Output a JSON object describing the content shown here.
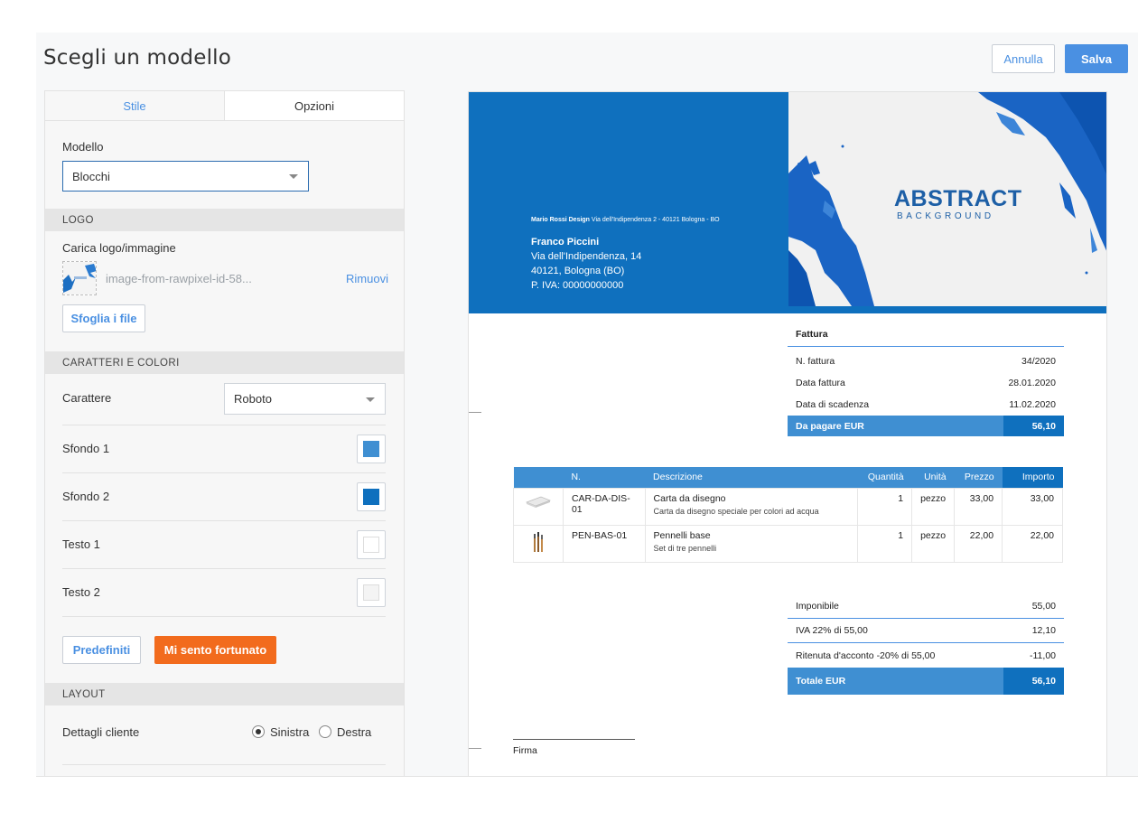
{
  "header": {
    "title": "Scegli un modello",
    "cancel_label": "Annulla",
    "save_label": "Salva"
  },
  "tabs": [
    {
      "label": "Stile",
      "active": true
    },
    {
      "label": "Opzioni",
      "active": false
    }
  ],
  "modello": {
    "label": "Modello",
    "value": "Blocchi"
  },
  "logo": {
    "section": "LOGO",
    "upload_label": "Carica logo/immagine",
    "filename": "image-from-rawpixel-id-58...",
    "remove_label": "Rimuovi",
    "browse_label": "Sfoglia i file"
  },
  "fonts_colors": {
    "section": "CARATTERI E COLORI",
    "font_label": "Carattere",
    "font_value": "Roboto",
    "colors": [
      {
        "label": "Sfondo 1",
        "color": "#3f8fd2"
      },
      {
        "label": "Sfondo 2",
        "color": "#0f70be"
      },
      {
        "label": "Testo 1",
        "color": "#ffffff"
      },
      {
        "label": "Testo 2",
        "color": "#f4f4f4"
      }
    ],
    "defaults_label": "Predefiniti",
    "lucky_label": "Mi sento fortunato"
  },
  "layout": {
    "section": "LAYOUT",
    "client_details_label": "Dettagli cliente",
    "options": [
      {
        "label": "Sinistra",
        "checked": true
      },
      {
        "label": "Destra",
        "checked": false
      }
    ]
  },
  "invoice": {
    "sender_name": "Mario Rossi Design",
    "sender_address": "Via dell'Indipendenza 2 - 40121 Bologna - BO",
    "client": {
      "name": "Franco Piccini",
      "street": "Via dell'Indipendenza, 14",
      "city": "40121, Bologna (BO)",
      "vat": "P. IVA: 00000000000"
    },
    "banner_title": "ABSTRACT",
    "banner_subtitle": "BACKGROUND",
    "doc_title": "Fattura",
    "meta": [
      {
        "label": "N. fattura",
        "value": "34/2020"
      },
      {
        "label": "Data fattura",
        "value": "28.01.2020"
      },
      {
        "label": "Data di scadenza",
        "value": "11.02.2020"
      }
    ],
    "due": {
      "label": "Da pagare EUR",
      "value": "56,10"
    },
    "columns": [
      "N.",
      "Descrizione",
      "Quantità",
      "Unità",
      "Prezzo",
      "Importo"
    ],
    "items": [
      {
        "code": "CAR-DA-DIS-01",
        "name": "Carta da disegno",
        "desc": "Carta da disegno speciale per colori ad acqua",
        "qty": "1",
        "unit": "pezzo",
        "price": "33,00",
        "amount": "33,00"
      },
      {
        "code": "PEN-BAS-01",
        "name": "Pennelli base",
        "desc": "Set di tre pennelli",
        "qty": "1",
        "unit": "pezzo",
        "price": "22,00",
        "amount": "22,00"
      }
    ],
    "totals": [
      {
        "label": "Imponibile",
        "value": "55,00"
      },
      {
        "label": "IVA 22% di 55,00",
        "value": "12,10"
      },
      {
        "label": "Ritenuta d'acconto -20% di 55,00",
        "value": "-11,00"
      }
    ],
    "grand_total": {
      "label": "Totale EUR",
      "value": "56,10"
    },
    "signature": "Firma"
  }
}
